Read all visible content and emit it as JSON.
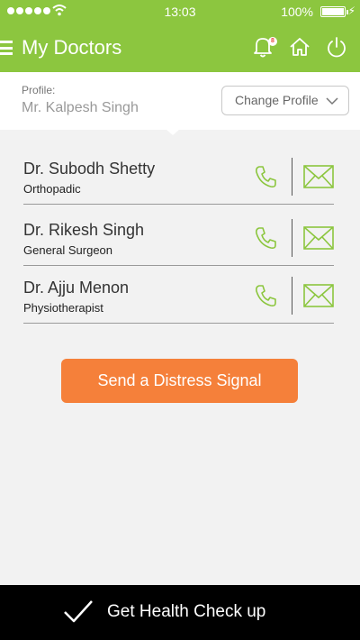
{
  "status_bar": {
    "time": "13:03",
    "battery": "100%"
  },
  "header": {
    "title": "My Doctors",
    "notification_count": "8"
  },
  "profile": {
    "caption": "Profile:",
    "name": "Mr. Kalpesh Singh",
    "change_label": "Change Profile"
  },
  "doctors": [
    {
      "name": "Dr. Subodh Shetty",
      "specialty": "Orthopadic"
    },
    {
      "name": "Dr. Rikesh Singh",
      "specialty": "General Surgeon"
    },
    {
      "name": "Dr. Ajju Menon",
      "specialty": "Physiotherapist"
    }
  ],
  "distress_label": "Send a Distress Signal",
  "footer": {
    "label": "Get Health Check up"
  },
  "colors": {
    "brand_green": "#8cc63f",
    "action_orange": "#f5803a",
    "footer_black": "#000000"
  }
}
